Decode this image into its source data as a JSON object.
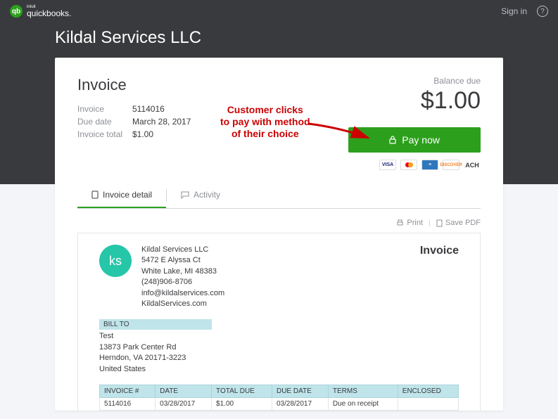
{
  "brand": {
    "small": "intuit",
    "main": "quickbooks.",
    "icon_letters": "qb"
  },
  "topbar": {
    "signin": "Sign in"
  },
  "company": "Kildal Services LLC",
  "invoice": {
    "title": "Invoice",
    "meta": {
      "invoice_label": "Invoice",
      "invoice_number": "5114016",
      "due_date_label": "Due date",
      "due_date": "March 28, 2017",
      "total_label": "Invoice total",
      "total": "$1.00"
    },
    "balance_due_label": "Balance due",
    "balance_due": "$1.00",
    "pay_now": "Pay now",
    "payment_methods": {
      "visa": "VISA",
      "discover": "DISCOVER",
      "ach": "ACH"
    }
  },
  "tabs": {
    "detail": "Invoice detail",
    "activity": "Activity"
  },
  "actions": {
    "print": "Print",
    "save_pdf": "Save PDF"
  },
  "doc": {
    "sender_avatar": "ks",
    "sender": {
      "name": "Kildal Services LLC",
      "addr1": "5472 E Alyssa Ct",
      "addr2": "White Lake, MI 48383",
      "phone": "(248)906-8706",
      "email": "info@kildalservices.com",
      "web": "KildalServices.com"
    },
    "title": "Invoice",
    "billto_label": "BILL TO",
    "billto": {
      "name": "Test",
      "addr1": "13873 Park Center Rd",
      "addr2": "Herndon, VA 20171-3223",
      "country": "United States"
    },
    "table": {
      "headers": {
        "invoice_no": "INVOICE #",
        "date": "DATE",
        "total_due": "TOTAL DUE",
        "due_date": "DUE DATE",
        "terms": "TERMS",
        "enclosed": "ENCLOSED"
      },
      "row": {
        "invoice_no": "5114016",
        "date": "03/28/2017",
        "total_due": "$1.00",
        "due_date": "03/28/2017",
        "terms": "Due on receipt",
        "enclosed": ""
      }
    }
  },
  "annotation": {
    "line1": "Customer clicks",
    "line2": "to pay with method",
    "line3": "of their choice"
  }
}
